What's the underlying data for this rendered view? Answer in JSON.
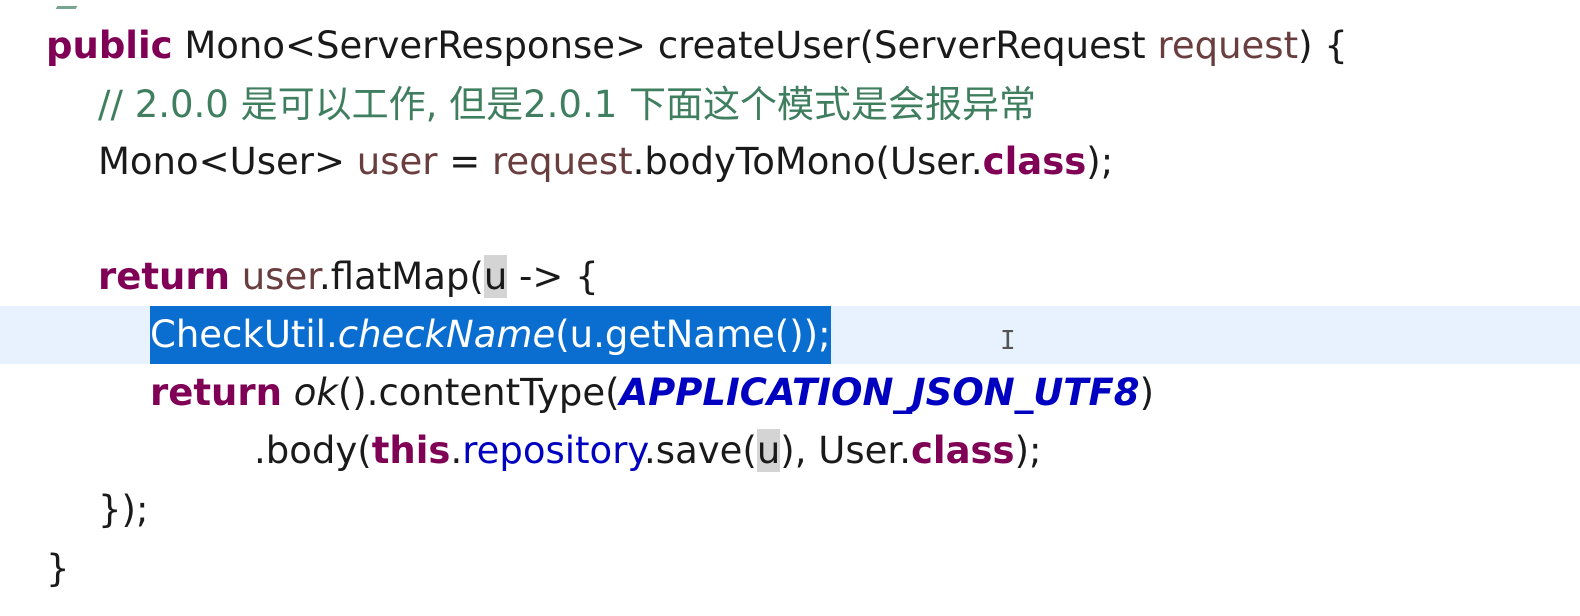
{
  "editor": {
    "lines": [
      {
        "tokens": [
          {
            "text": "public",
            "style": "keyword"
          },
          {
            "text": " Mono<ServerResponse> createUser(ServerRequest ",
            "style": "plain"
          },
          {
            "text": "request",
            "style": "param"
          },
          {
            "text": ") {",
            "style": "plain"
          }
        ]
      },
      {
        "tokens": [
          {
            "text": "// 2.0.0 是可以工作, 但是2.0.1 下面这个模式是会报异常",
            "style": "comment"
          }
        ]
      },
      {
        "tokens": [
          {
            "text": "Mono<User> ",
            "style": "plain"
          },
          {
            "text": "user",
            "style": "param"
          },
          {
            "text": " = ",
            "style": "plain"
          },
          {
            "text": "request",
            "style": "param"
          },
          {
            "text": ".bodyToMono(User.",
            "style": "plain"
          },
          {
            "text": "class",
            "style": "keyword"
          },
          {
            "text": ");",
            "style": "plain"
          }
        ]
      },
      {
        "tokens": []
      },
      {
        "tokens": [
          {
            "text": "return",
            "style": "keyword"
          },
          {
            "text": " ",
            "style": "plain"
          },
          {
            "text": "user",
            "style": "param"
          },
          {
            "text": ".flatMap(",
            "style": "plain"
          },
          {
            "text": "u",
            "style": "occ"
          },
          {
            "text": " -> {",
            "style": "plain"
          }
        ]
      },
      {
        "tokens": [
          {
            "text": "CheckUtil.",
            "style": "plain"
          },
          {
            "text": "checkName",
            "style": "static"
          },
          {
            "text": "(u.getName());",
            "style": "plain"
          }
        ]
      },
      {
        "tokens": [
          {
            "text": "return",
            "style": "keyword"
          },
          {
            "text": " ",
            "style": "plain"
          },
          {
            "text": "ok",
            "style": "static"
          },
          {
            "text": "().contentType(",
            "style": "plain"
          },
          {
            "text": "APPLICATION_JSON_UTF8",
            "style": "constant"
          },
          {
            "text": ")",
            "style": "plain"
          }
        ]
      },
      {
        "tokens": [
          {
            "text": ".body(",
            "style": "plain"
          },
          {
            "text": "this",
            "style": "keyword"
          },
          {
            "text": ".",
            "style": "plain"
          },
          {
            "text": "repository",
            "style": "field"
          },
          {
            "text": ".save(",
            "style": "plain"
          },
          {
            "text": "u",
            "style": "occ"
          },
          {
            "text": "), User.",
            "style": "plain"
          },
          {
            "text": "class",
            "style": "keyword"
          },
          {
            "text": ");",
            "style": "plain"
          }
        ]
      },
      {
        "tokens": [
          {
            "text": "});",
            "style": "plain"
          }
        ]
      },
      {
        "tokens": [
          {
            "text": "}",
            "style": "plain"
          }
        ]
      }
    ],
    "selected_line_index": 5,
    "current_line_index": 5,
    "colors": {
      "keyword": "#7f0055",
      "comment": "#3f7f5f",
      "param": "#6a3e3e",
      "field": "#0000c0",
      "selection": "#0a6ed1",
      "current_line": "#e8f2fe"
    },
    "cursor_icon": "text-cursor-icon"
  }
}
